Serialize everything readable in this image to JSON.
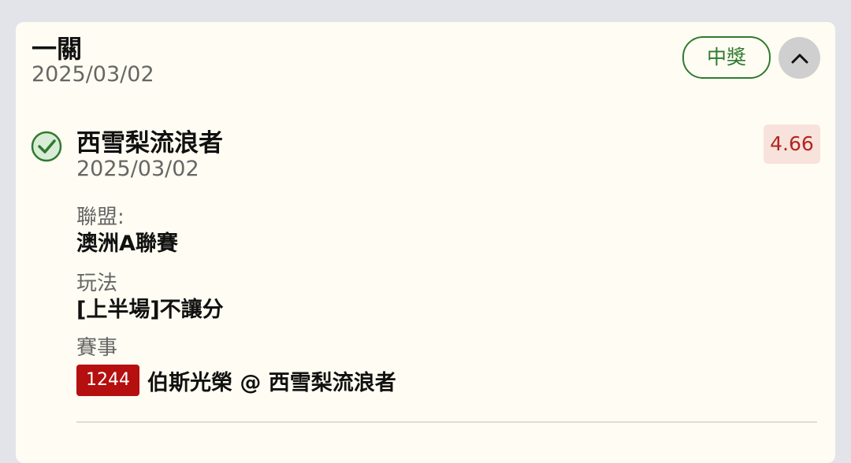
{
  "bet": {
    "type_title": "一關",
    "date": "2025/03/02",
    "status_label": "中獎",
    "collapse_icon": "chevron-up-icon"
  },
  "leg": {
    "selection": "西雪梨流浪者",
    "date": "2025/03/02",
    "odds": "4.66",
    "result_icon": "check-circle-icon",
    "league_label": "聯盟:",
    "league_value": "澳洲A聯賽",
    "play_label": "玩法",
    "play_value": "[上半場]不讓分",
    "match_label": "賽事",
    "match_number": "1244",
    "match_name": "伯斯光榮 @ 西雪梨流浪者"
  },
  "colors": {
    "win_green": "#2f7a2f",
    "odds_red": "#b1271e",
    "match_badge_red": "#b50f0f",
    "card_bg": "#fffdf3"
  }
}
